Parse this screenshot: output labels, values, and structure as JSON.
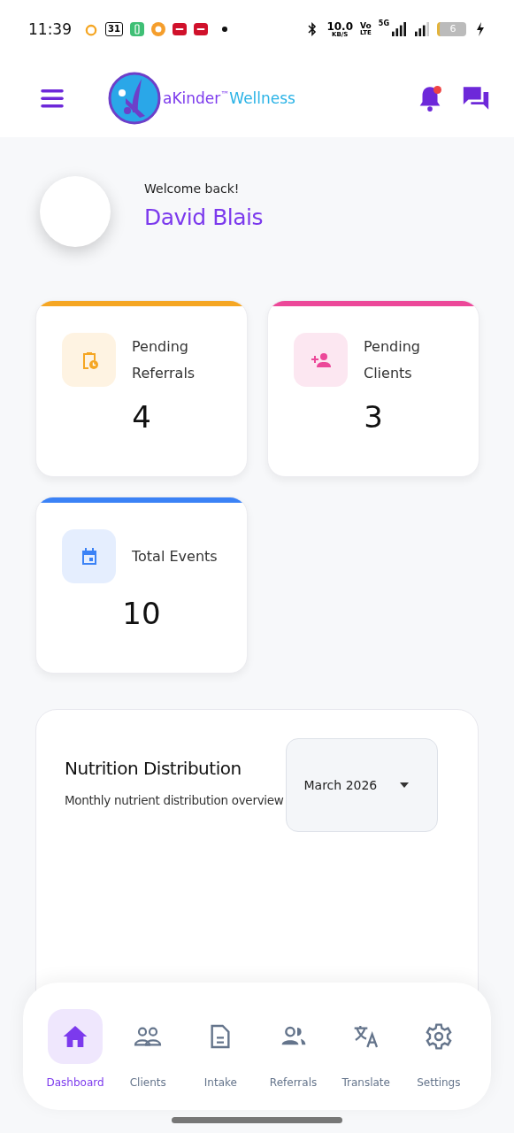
{
  "status_bar": {
    "time": "11:39",
    "calendar_day": "31",
    "speed": "10.0",
    "speed_unit": "KB/S",
    "volte": "Vo",
    "lte": "LTE",
    "network": "5G",
    "battery": "6"
  },
  "header": {
    "brand_main": "aKinder",
    "brand_tm": "™",
    "brand_accent": "Wellness",
    "has_notification": true
  },
  "profile": {
    "greeting": "Welcome back!",
    "name": "David Blais"
  },
  "stats": [
    {
      "label": "Pending Referrals",
      "value": "4",
      "kind": "clipboard",
      "color": "#f5a623"
    },
    {
      "label": "Pending Clients",
      "value": "3",
      "kind": "person",
      "color": "#ec4899"
    },
    {
      "label": "Total Events",
      "value": "10",
      "kind": "calendar",
      "color": "#3b82f6"
    }
  ],
  "nutrition": {
    "title": "Nutrition Distribution",
    "subtitle": "Monthly nutrient distribution overview",
    "month": "March 2026"
  },
  "nav": [
    {
      "label": "Dashboard",
      "kind": "home",
      "selected": true
    },
    {
      "label": "Clients",
      "kind": "people",
      "selected": false
    },
    {
      "label": "Intake",
      "kind": "document",
      "selected": false
    },
    {
      "label": "Referrals",
      "kind": "group",
      "selected": false
    },
    {
      "label": "Translate",
      "kind": "translate",
      "selected": false
    },
    {
      "label": "Settings",
      "kind": "gear",
      "selected": false
    }
  ]
}
